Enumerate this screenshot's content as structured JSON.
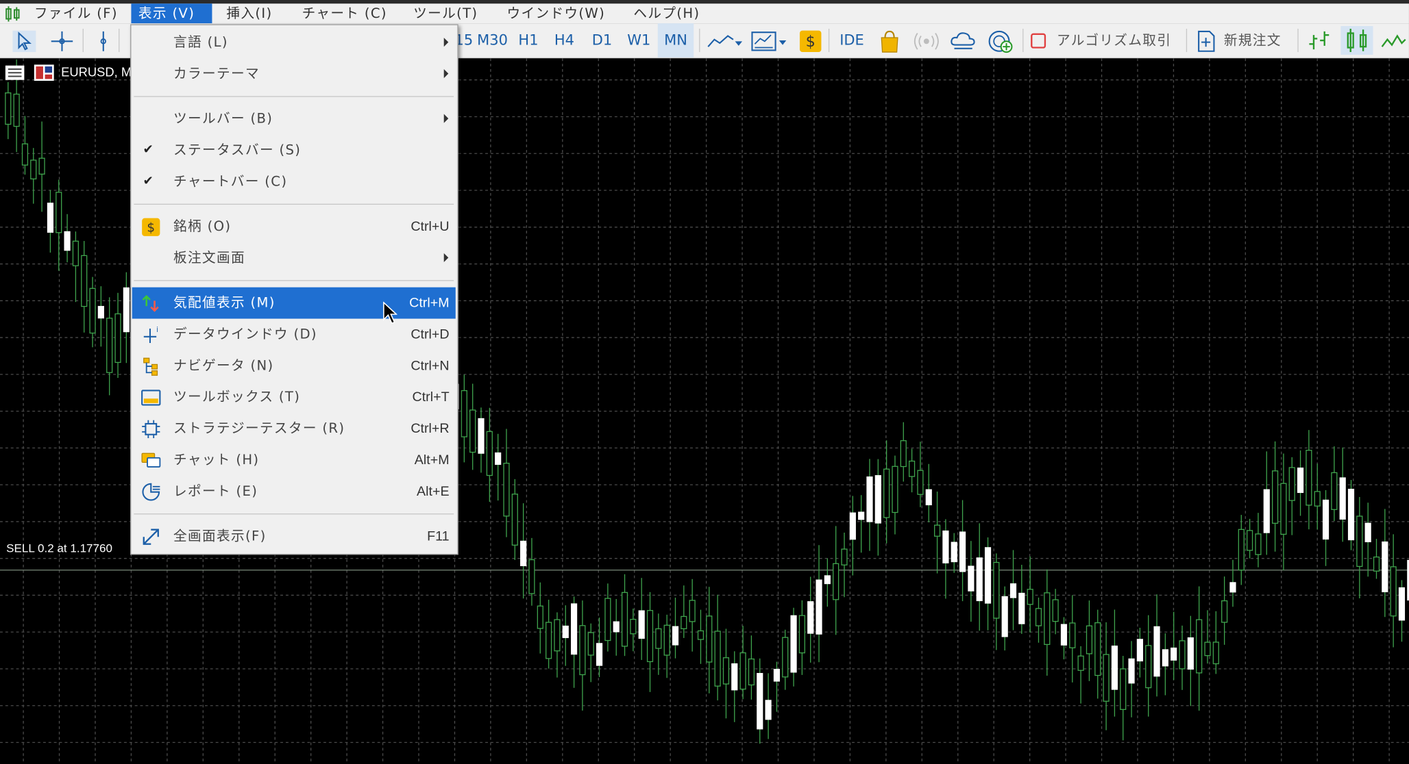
{
  "menubar": {
    "items": [
      {
        "label": "ファイル (F)"
      },
      {
        "label": "表示 (V)"
      },
      {
        "label": "挿入(I)"
      },
      {
        "label": "チャート (C)"
      },
      {
        "label": "ツール(T)"
      },
      {
        "label": "ウインドウ(W)"
      },
      {
        "label": "ヘルプ(H)"
      }
    ]
  },
  "toolbar": {
    "timeframes": [
      "15",
      "M30",
      "H1",
      "H4",
      "D1",
      "W1",
      "MN"
    ],
    "active_timeframe": "MN",
    "ide_label": "IDE",
    "algo_label": "アルゴリズム取引",
    "new_order_label": "新規注文"
  },
  "chart": {
    "title": "EURUSD, Mo",
    "trade_label": "SELL 0.2 at 1.17760",
    "colors": {
      "bg": "#000000",
      "grid": "#4a4a4a",
      "up": "#ffffff",
      "wick": "#3fa34d"
    }
  },
  "menu": {
    "language": "言語 (L)",
    "color_theme": "カラーテーマ",
    "toolbar": "ツールバー (B)",
    "status_bar": "ステータスバー (S)",
    "chart_bar": "チャートバー (C)",
    "symbols": "銘柄 (O)",
    "symbols_sc": "Ctrl+U",
    "depth": "板注文画面",
    "market_watch": "気配値表示 (M)",
    "market_watch_sc": "Ctrl+M",
    "data_window": "データウインドウ (D)",
    "data_window_sc": "Ctrl+D",
    "navigator": "ナビゲータ (N)",
    "navigator_sc": "Ctrl+N",
    "toolbox": "ツールボックス (T)",
    "toolbox_sc": "Ctrl+T",
    "tester": "ストラテジーテスター (R)",
    "tester_sc": "Ctrl+R",
    "chat": "チャット (H)",
    "chat_sc": "Alt+M",
    "reports": "レポート (E)",
    "reports_sc": "Alt+E",
    "fullscreen": "全画面表示(F)",
    "fullscreen_sc": "F11"
  }
}
